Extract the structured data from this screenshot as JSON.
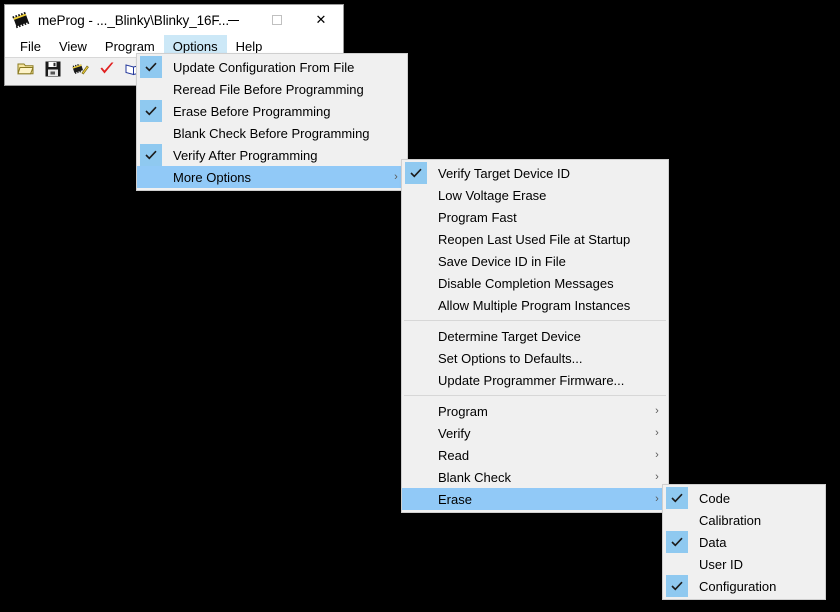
{
  "window": {
    "title": "meProg - ..._Blinky\\Blinky_16F...",
    "icon": "chip-icon",
    "controls": {
      "minimize": "minimize-icon",
      "maximize": "maximize-icon",
      "close": "✕"
    }
  },
  "menubar": {
    "items": [
      {
        "label": "File",
        "active": false
      },
      {
        "label": "View",
        "active": false
      },
      {
        "label": "Program",
        "active": false
      },
      {
        "label": "Options",
        "active": true
      },
      {
        "label": "Help",
        "active": false
      }
    ]
  },
  "toolbar": {
    "buttons": [
      {
        "name": "open-file-icon"
      },
      {
        "name": "save-file-icon"
      },
      {
        "name": "program-device-icon"
      },
      {
        "name": "verify-icon"
      },
      {
        "name": "read-device-icon"
      },
      {
        "name": "blank-check-icon"
      }
    ]
  },
  "options_menu": {
    "items": [
      {
        "label": "Update Configuration From File",
        "checked": true,
        "highlight": false,
        "submenu": false
      },
      {
        "label": "Reread File Before Programming",
        "checked": false,
        "highlight": false,
        "submenu": false
      },
      {
        "label": "Erase Before Programming",
        "checked": true,
        "highlight": false,
        "submenu": false
      },
      {
        "label": "Blank Check Before Programming",
        "checked": false,
        "highlight": false,
        "submenu": false
      },
      {
        "label": "Verify After Programming",
        "checked": true,
        "highlight": false,
        "submenu": false
      },
      {
        "label": "More Options",
        "checked": false,
        "highlight": true,
        "submenu": true
      }
    ]
  },
  "more_options_menu": {
    "group1": [
      {
        "label": "Verify Target Device ID",
        "checked": true,
        "highlight": false,
        "submenu": false
      },
      {
        "label": "Low Voltage Erase",
        "checked": false,
        "highlight": false,
        "submenu": false
      },
      {
        "label": "Program Fast",
        "checked": false,
        "highlight": false,
        "submenu": false
      },
      {
        "label": "Reopen Last Used File at Startup",
        "checked": false,
        "highlight": false,
        "submenu": false
      },
      {
        "label": "Save Device ID in File",
        "checked": false,
        "highlight": false,
        "submenu": false
      },
      {
        "label": "Disable Completion Messages",
        "checked": false,
        "highlight": false,
        "submenu": false
      },
      {
        "label": "Allow Multiple Program Instances",
        "checked": false,
        "highlight": false,
        "submenu": false
      }
    ],
    "group2": [
      {
        "label": "Determine Target Device",
        "checked": false,
        "highlight": false,
        "submenu": false
      },
      {
        "label": "Set Options to Defaults...",
        "checked": false,
        "highlight": false,
        "submenu": false
      },
      {
        "label": "Update Programmer Firmware...",
        "checked": false,
        "highlight": false,
        "submenu": false
      }
    ],
    "group3": [
      {
        "label": "Program",
        "checked": false,
        "highlight": false,
        "submenu": true
      },
      {
        "label": "Verify",
        "checked": false,
        "highlight": false,
        "submenu": true
      },
      {
        "label": "Read",
        "checked": false,
        "highlight": false,
        "submenu": true
      },
      {
        "label": "Blank Check",
        "checked": false,
        "highlight": false,
        "submenu": true
      },
      {
        "label": "Erase",
        "checked": false,
        "highlight": true,
        "submenu": true
      }
    ]
  },
  "erase_menu": {
    "items": [
      {
        "label": "Code",
        "checked": true,
        "highlight": false,
        "submenu": false
      },
      {
        "label": "Calibration",
        "checked": false,
        "highlight": false,
        "submenu": false
      },
      {
        "label": "Data",
        "checked": true,
        "highlight": false,
        "submenu": false
      },
      {
        "label": "User ID",
        "checked": false,
        "highlight": false,
        "submenu": false
      },
      {
        "label": "Configuration",
        "checked": true,
        "highlight": false,
        "submenu": false
      }
    ]
  },
  "colors": {
    "menu_bg": "#f0f0f0",
    "highlight": "#91c9f7",
    "check_bg": "#8fc9f0",
    "menubar_active": "#cce8f7",
    "desktop": "#000000"
  }
}
